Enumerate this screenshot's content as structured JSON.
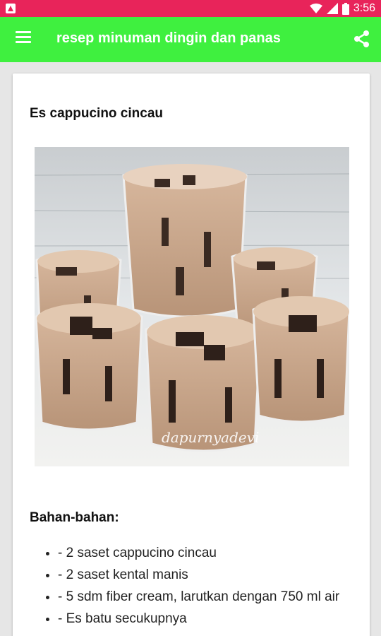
{
  "status_bar": {
    "time": "3:56",
    "color": "#e8245a",
    "icons": [
      "notification-icon",
      "wifi-icon",
      "signal-icon",
      "battery-icon"
    ]
  },
  "app_bar": {
    "title": "resep minuman dingin dan panas",
    "color": "#3ff03f",
    "icons": [
      "menu-icon",
      "share-icon"
    ]
  },
  "recipe": {
    "title": "Es cappucino cincau",
    "photo_watermark": "dapurnyadevi",
    "ingredients_heading": "Bahan-bahan:",
    "ingredients": [
      "- 2 saset cappucino cincau",
      "- 2 saset kental manis",
      "- 5 sdm fiber cream, larutkan dengan 750 ml air",
      "- Es batu secukupnya"
    ]
  }
}
